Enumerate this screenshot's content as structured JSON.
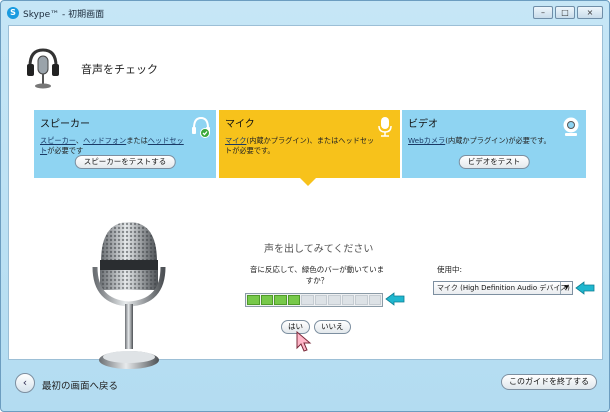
{
  "window": {
    "title": "Skype™ - 初期画面",
    "app_icon": "S",
    "minimize": "–",
    "maximize": "□",
    "close": "×"
  },
  "header": {
    "title": "音声をチェック",
    "icon": "headset-mic-icon"
  },
  "cards": {
    "speaker": {
      "title": "スピーカー",
      "link1": "スピーカー",
      "sep1": "、",
      "link2": "ヘッドフォン",
      "mid": "または",
      "link3": "ヘッドセット",
      "tail": "が必要です",
      "button": "スピーカーをテストする",
      "icon": "headphones-check-icon"
    },
    "mic": {
      "title": "マイク",
      "link1": "マイク",
      "tail": "(内蔵かプラグイン)、またはヘッドセットが必要です。",
      "icon": "microphone-icon"
    },
    "video": {
      "title": "ビデオ",
      "link1": "Webカメラ",
      "tail": "(内蔵かプラグイン)が必要です。",
      "button": "ビデオをテスト",
      "icon": "webcam-icon"
    }
  },
  "main": {
    "instruction_title": "声を出してみてください",
    "instruction_text": "音に反応して、緑色のバーが動いていますか？",
    "meter": {
      "total_segments": 10,
      "active_segments": 4
    },
    "yes": "はい",
    "no": "いいえ",
    "using_label": "使用中:",
    "device": "マイク (High Definition Audio デバイス)"
  },
  "footer": {
    "back": "最初の画面へ戻る",
    "end": "このガイドを終了する"
  },
  "colors": {
    "mic_card": "#f7c21b",
    "side_card": "#8fd4f2",
    "meter_on": "#77c94a",
    "arrow": "#1fb7cf"
  }
}
